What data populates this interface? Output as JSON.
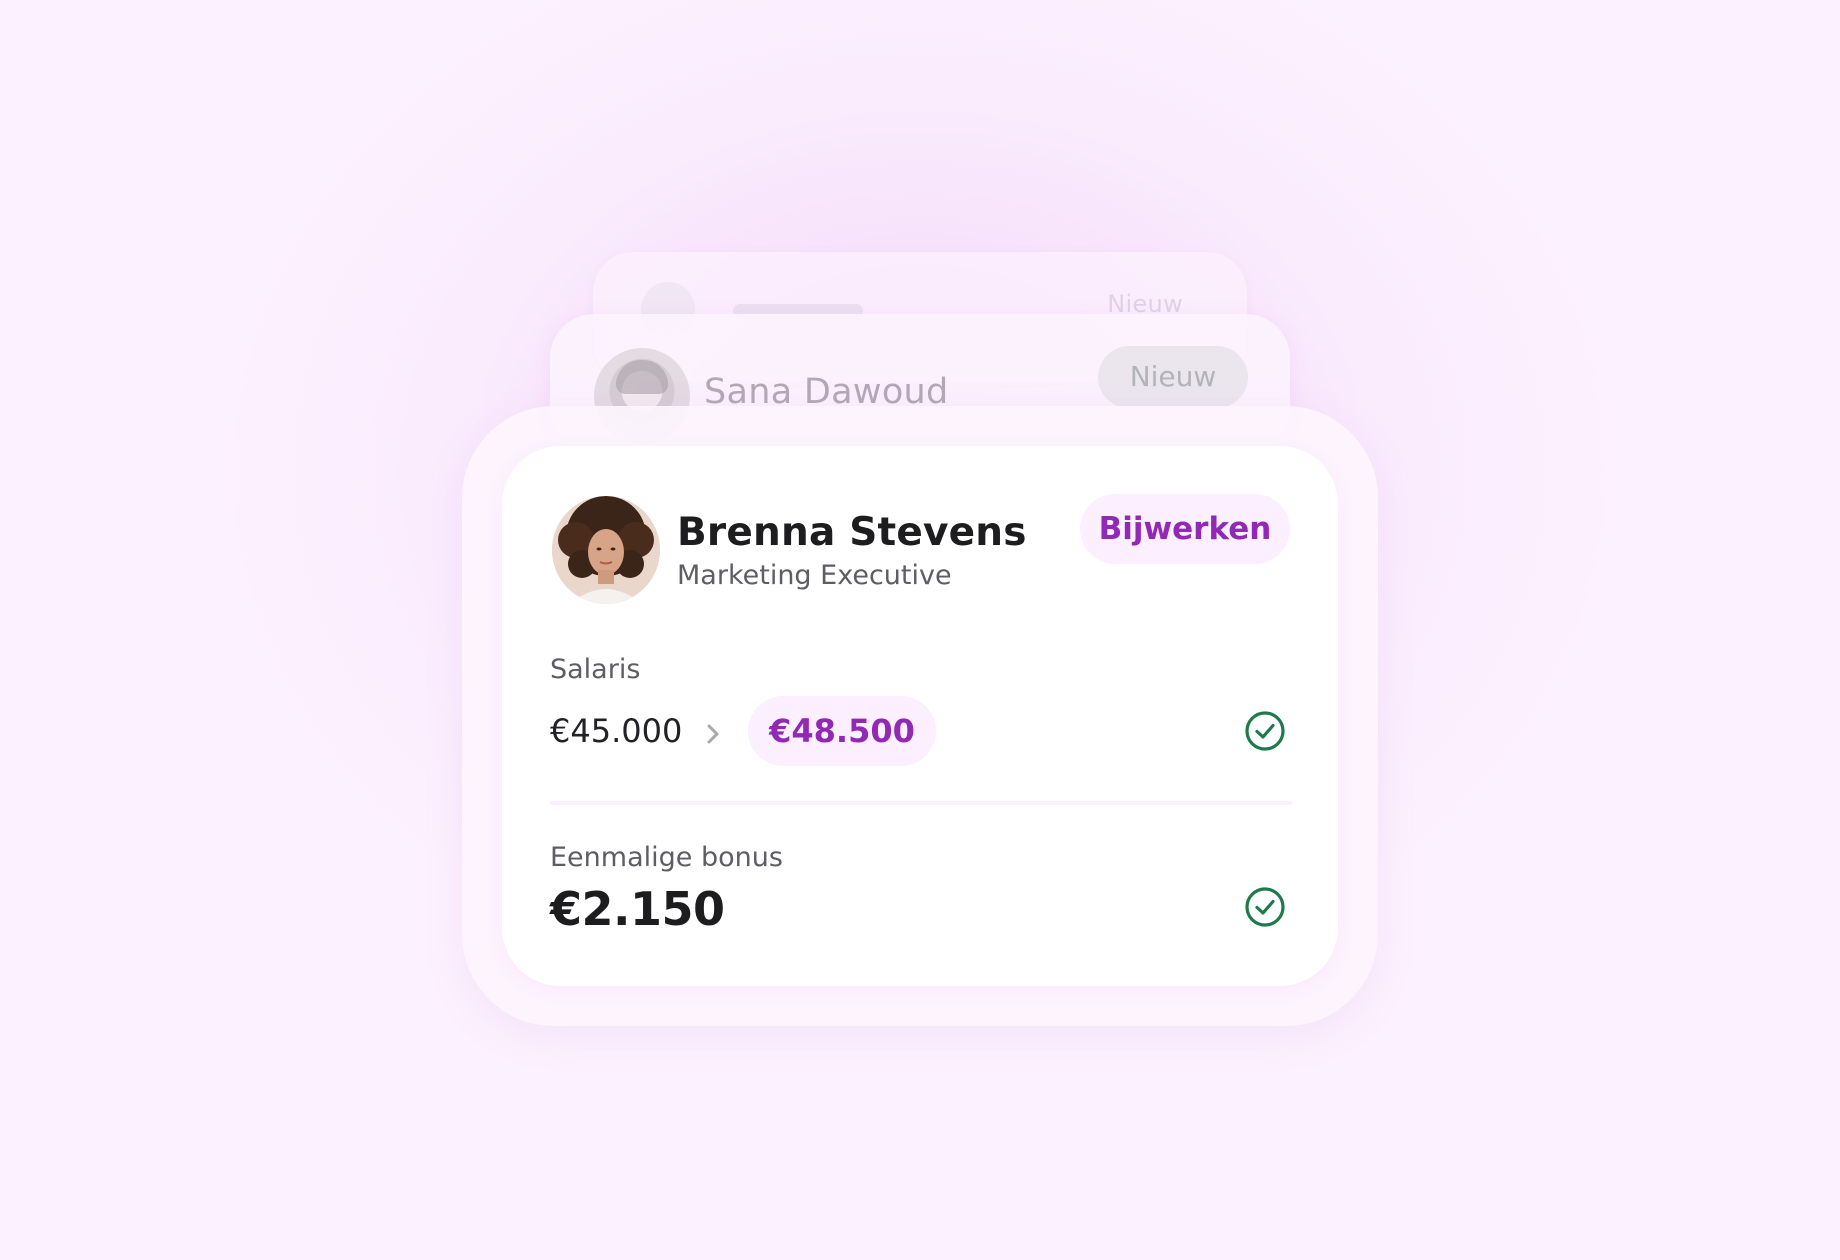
{
  "background_card": {
    "badge_label": "Nieuw"
  },
  "middle_card": {
    "name": "Sana Dawoud",
    "badge_label": "Nieuw"
  },
  "employee": {
    "name": "Brenna Stevens",
    "role": "Marketing Executive",
    "update_button_label": "Bijwerken"
  },
  "salary": {
    "label": "Salaris",
    "old_value": "€45.000",
    "new_value": "€48.500",
    "status_icon": "check-circle-icon"
  },
  "bonus": {
    "label": "Eenmalige bonus",
    "value": "€2.150",
    "status_icon": "check-circle-icon"
  },
  "colors": {
    "accent": "#9129b5",
    "accent_bg": "#fcefff",
    "success": "#1e7a4a",
    "text_primary": "#1d1c1f",
    "text_secondary": "#5f5d64"
  }
}
